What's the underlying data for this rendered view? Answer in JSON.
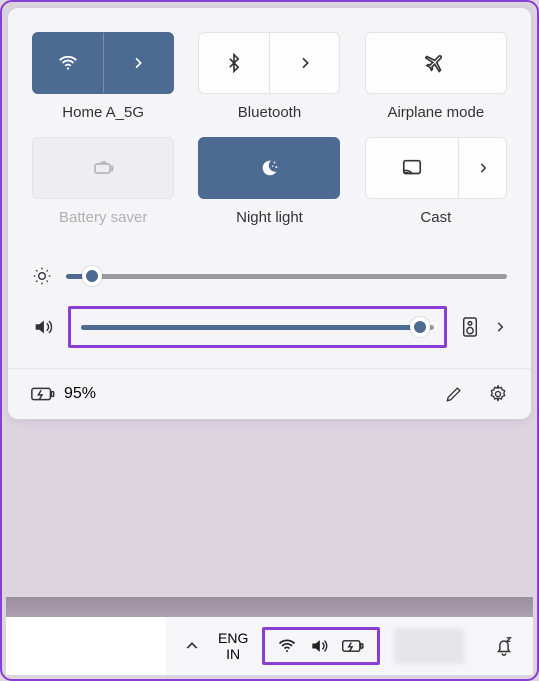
{
  "tiles": {
    "wifi": {
      "label": "Home A_5G",
      "active": true
    },
    "bluetooth": {
      "label": "Bluetooth",
      "active": false
    },
    "airplane": {
      "label": "Airplane mode",
      "active": false
    },
    "battery": {
      "label": "Battery saver",
      "active": false,
      "disabled": true
    },
    "nightlight": {
      "label": "Night light",
      "active": true
    },
    "cast": {
      "label": "Cast",
      "active": false
    }
  },
  "sliders": {
    "brightness": {
      "percent": 6
    },
    "volume": {
      "percent": 96
    }
  },
  "battery": {
    "percent_label": "95%"
  },
  "taskbar": {
    "lang_top": "ENG",
    "lang_bottom": "IN"
  }
}
